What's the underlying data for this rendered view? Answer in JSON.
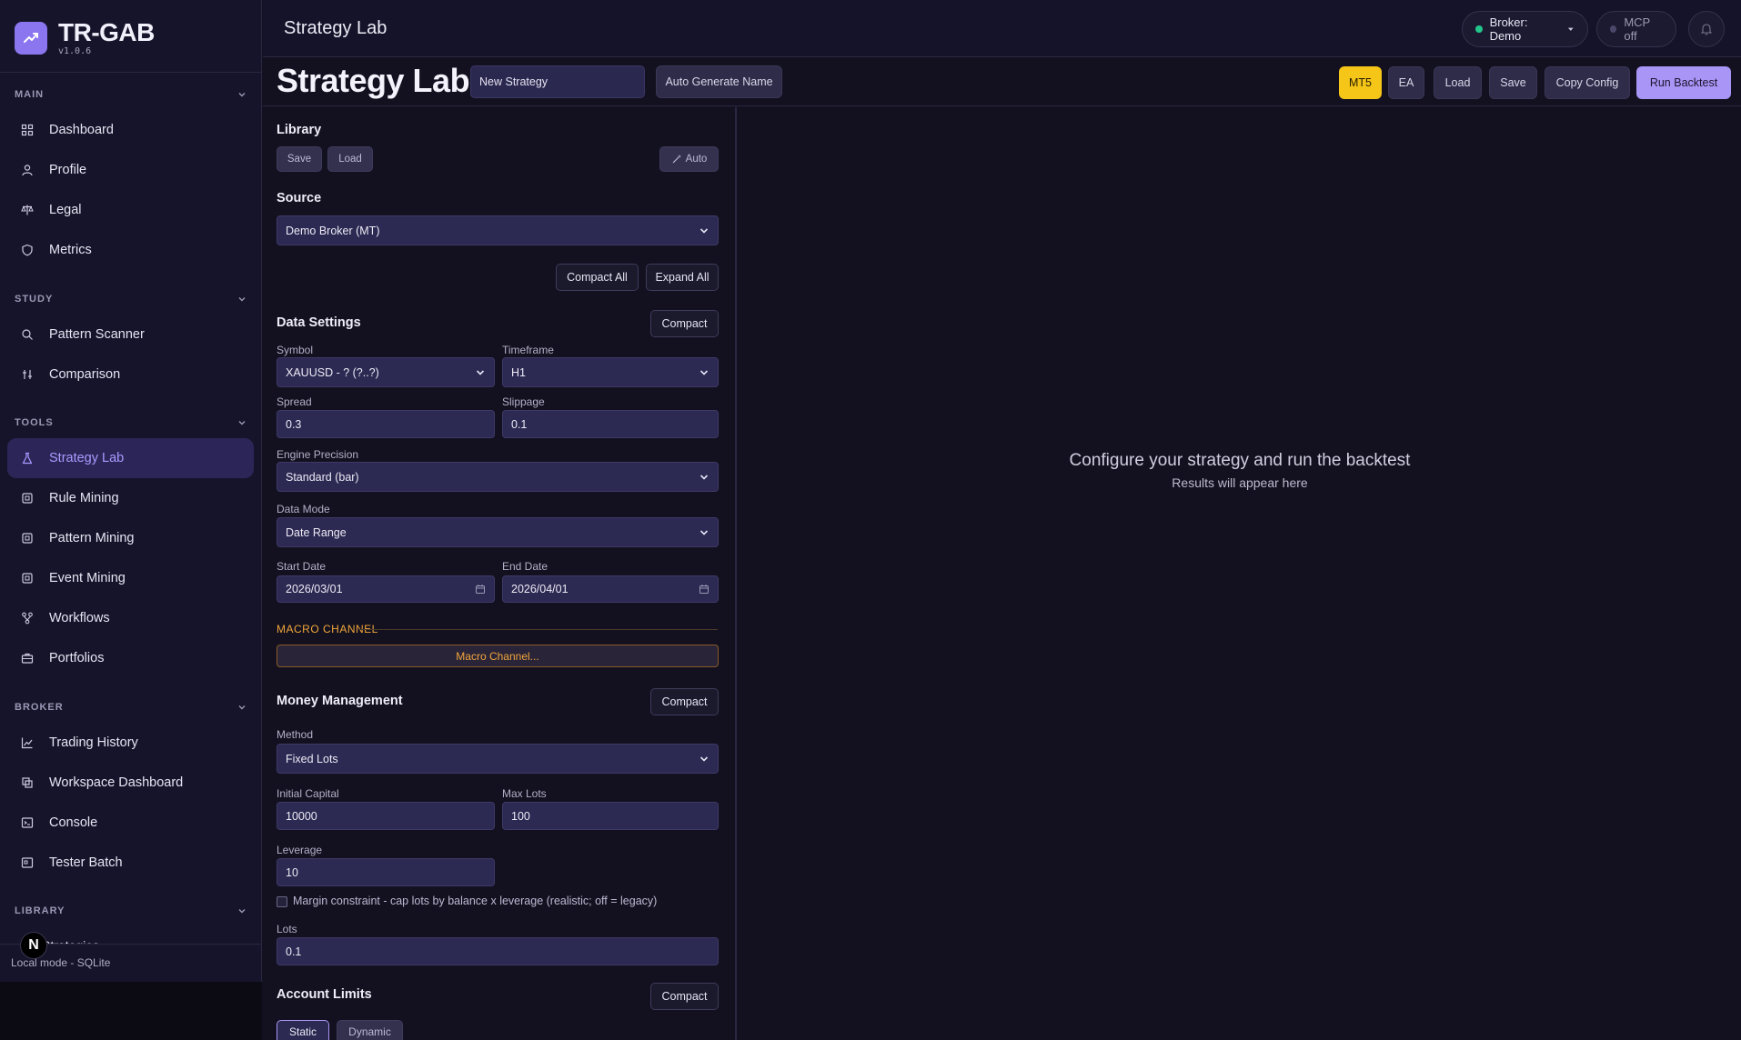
{
  "brand": {
    "name": "TR-GAB",
    "version": "v1.0.6"
  },
  "sidebar": {
    "sections": [
      {
        "title": "MAIN",
        "items": [
          "Dashboard",
          "Profile",
          "Legal",
          "Metrics"
        ]
      },
      {
        "title": "STUDY",
        "items": [
          "Pattern Scanner",
          "Comparison"
        ]
      },
      {
        "title": "TOOLS",
        "items": [
          "Strategy Lab",
          "Rule Mining",
          "Pattern Mining",
          "Event Mining",
          "Workflows",
          "Portfolios"
        ]
      },
      {
        "title": "BROKER",
        "items": [
          "Trading History",
          "Workspace Dashboard",
          "Console",
          "Tester Batch"
        ]
      },
      {
        "title": "LIBRARY",
        "items": [
          "Strategies"
        ]
      }
    ],
    "active_item": "Strategy Lab",
    "footer": "Local mode - SQLite",
    "badge": "N"
  },
  "topbar": {
    "title": "Strategy Lab",
    "broker_label": "Broker: Demo",
    "mcp_label": "MCP off"
  },
  "header": {
    "title": "Strategy Lab",
    "strategy_name": "New Strategy",
    "auto_name_label": "Auto Generate Name",
    "mt5_label": "MT5",
    "ea_label": "EA",
    "load_label": "Load",
    "save_label": "Save",
    "copy_config_label": "Copy Config",
    "run_label": "Run Backtest"
  },
  "library": {
    "title": "Library",
    "save_label": "Save",
    "load_label": "Load",
    "auto_label": "Auto"
  },
  "source": {
    "title": "Source",
    "value": "Demo Broker (MT)",
    "compact_all_label": "Compact All",
    "expand_all_label": "Expand All"
  },
  "data_settings": {
    "title": "Data Settings",
    "compact_label": "Compact",
    "symbol_label": "Symbol",
    "symbol_value": "XAUUSD - ? (?..?)",
    "timeframe_label": "Timeframe",
    "timeframe_value": "H1",
    "spread_label": "Spread",
    "spread_value": "0.3",
    "slippage_label": "Slippage",
    "slippage_value": "0.1",
    "precision_label": "Engine Precision",
    "precision_value": "Standard (bar)",
    "mode_label": "Data Mode",
    "mode_value": "Date Range",
    "start_label": "Start Date",
    "start_value": "2026/03/01",
    "end_label": "End Date",
    "end_value": "2026/04/01"
  },
  "macro": {
    "label": "MACRO CHANNEL",
    "button": "Macro Channel..."
  },
  "money": {
    "title": "Money Management",
    "compact_label": "Compact",
    "method_label": "Method",
    "method_value": "Fixed Lots",
    "capital_label": "Initial Capital",
    "capital_value": "10000",
    "maxlots_label": "Max Lots",
    "maxlots_value": "100",
    "leverage_label": "Leverage",
    "leverage_value": "10",
    "margin_label": "Margin constraint - cap lots by balance x leverage (realistic; off = legacy)",
    "lots_label": "Lots",
    "lots_value": "0.1"
  },
  "limits": {
    "title": "Account Limits",
    "compact_label": "Compact",
    "static_label": "Static",
    "dynamic_label": "Dynamic"
  },
  "results": {
    "message": "Configure your strategy and run the backtest",
    "sub": "Results will appear here"
  },
  "colors": {
    "accent": "#a995f5",
    "mt5": "#f5c518",
    "macro": "#f0a53a",
    "status_ok": "#22c58b"
  }
}
